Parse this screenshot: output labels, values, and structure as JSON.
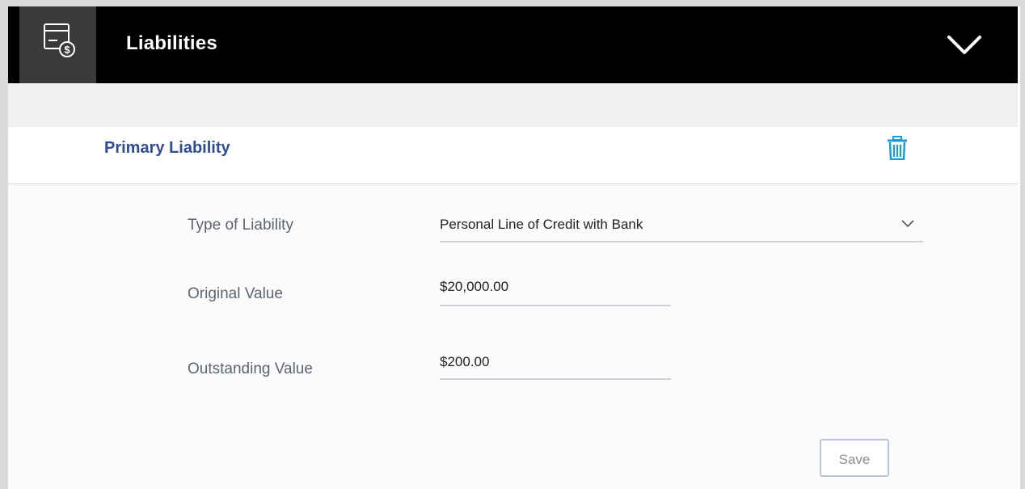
{
  "header": {
    "title": "Liabilities",
    "icon": "card-dollar-icon",
    "expand_icon": "chevron-down-icon"
  },
  "section": {
    "title": "Primary Liability",
    "delete_icon": "trash-icon",
    "accent_color": "#1e9bd7"
  },
  "form": {
    "type_label": "Type of Liability",
    "type_value": "Personal Line of Credit with Bank",
    "original_label": "Original Value",
    "original_value": "$20,000.00",
    "outstanding_label": "Outstanding Value",
    "outstanding_value": "$200.00",
    "save_label": "Save"
  }
}
